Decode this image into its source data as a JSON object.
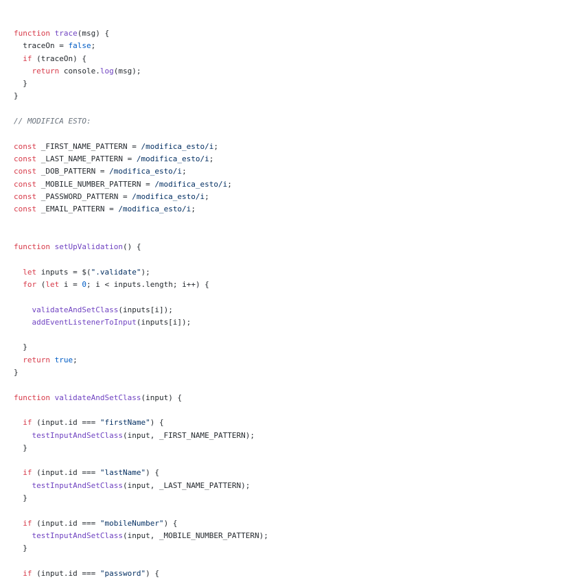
{
  "lines": [
    [
      {
        "t": "kw",
        "v": "function"
      },
      {
        "t": "p",
        "v": " "
      },
      {
        "t": "fn",
        "v": "trace"
      },
      {
        "t": "p",
        "v": "(msg) {"
      }
    ],
    [
      {
        "t": "p",
        "v": "  traceOn = "
      },
      {
        "t": "lit",
        "v": "false"
      },
      {
        "t": "p",
        "v": ";"
      }
    ],
    [
      {
        "t": "p",
        "v": "  "
      },
      {
        "t": "kw",
        "v": "if"
      },
      {
        "t": "p",
        "v": " (traceOn) {"
      }
    ],
    [
      {
        "t": "p",
        "v": "    "
      },
      {
        "t": "kw",
        "v": "return"
      },
      {
        "t": "p",
        "v": " console."
      },
      {
        "t": "fn",
        "v": "log"
      },
      {
        "t": "p",
        "v": "(msg);"
      }
    ],
    [
      {
        "t": "p",
        "v": "  }"
      }
    ],
    [
      {
        "t": "p",
        "v": "}"
      }
    ],
    [],
    [
      {
        "t": "cm",
        "v": "// MODIFICA ESTO:"
      }
    ],
    [],
    [
      {
        "t": "kw",
        "v": "const"
      },
      {
        "t": "p",
        "v": " _FIRST_NAME_PATTERN = "
      },
      {
        "t": "str",
        "v": "/modifica_esto/i"
      },
      {
        "t": "p",
        "v": ";"
      }
    ],
    [
      {
        "t": "kw",
        "v": "const"
      },
      {
        "t": "p",
        "v": " _LAST_NAME_PATTERN = "
      },
      {
        "t": "str",
        "v": "/modifica_esto/i"
      },
      {
        "t": "p",
        "v": ";"
      }
    ],
    [
      {
        "t": "kw",
        "v": "const"
      },
      {
        "t": "p",
        "v": " _DOB_PATTERN = "
      },
      {
        "t": "str",
        "v": "/modifica_esto/i"
      },
      {
        "t": "p",
        "v": ";"
      }
    ],
    [
      {
        "t": "kw",
        "v": "const"
      },
      {
        "t": "p",
        "v": " _MOBILE_NUMBER_PATTERN = "
      },
      {
        "t": "str",
        "v": "/modifica_esto/i"
      },
      {
        "t": "p",
        "v": ";"
      }
    ],
    [
      {
        "t": "kw",
        "v": "const"
      },
      {
        "t": "p",
        "v": " _PASSWORD_PATTERN = "
      },
      {
        "t": "str",
        "v": "/modifica_esto/i"
      },
      {
        "t": "p",
        "v": ";"
      }
    ],
    [
      {
        "t": "kw",
        "v": "const"
      },
      {
        "t": "p",
        "v": " _EMAIL_PATTERN = "
      },
      {
        "t": "str",
        "v": "/modifica_esto/i"
      },
      {
        "t": "p",
        "v": ";"
      }
    ],
    [],
    [],
    [
      {
        "t": "kw",
        "v": "function"
      },
      {
        "t": "p",
        "v": " "
      },
      {
        "t": "fn",
        "v": "setUpValidation"
      },
      {
        "t": "p",
        "v": "() {"
      }
    ],
    [],
    [
      {
        "t": "p",
        "v": "  "
      },
      {
        "t": "kw",
        "v": "let"
      },
      {
        "t": "p",
        "v": " inputs = $("
      },
      {
        "t": "str",
        "v": "\".validate\""
      },
      {
        "t": "p",
        "v": ");"
      }
    ],
    [
      {
        "t": "p",
        "v": "  "
      },
      {
        "t": "kw",
        "v": "for"
      },
      {
        "t": "p",
        "v": " ("
      },
      {
        "t": "kw",
        "v": "let"
      },
      {
        "t": "p",
        "v": " i = "
      },
      {
        "t": "lit",
        "v": "0"
      },
      {
        "t": "p",
        "v": "; i < inputs.length; i++) {"
      }
    ],
    [],
    [
      {
        "t": "p",
        "v": "    "
      },
      {
        "t": "fn",
        "v": "validateAndSetClass"
      },
      {
        "t": "p",
        "v": "(inputs[i]);"
      }
    ],
    [
      {
        "t": "p",
        "v": "    "
      },
      {
        "t": "fn",
        "v": "addEventListenerToInput"
      },
      {
        "t": "p",
        "v": "(inputs[i]);"
      }
    ],
    [],
    [
      {
        "t": "p",
        "v": "  }"
      }
    ],
    [
      {
        "t": "p",
        "v": "  "
      },
      {
        "t": "kw",
        "v": "return"
      },
      {
        "t": "p",
        "v": " "
      },
      {
        "t": "lit",
        "v": "true"
      },
      {
        "t": "p",
        "v": ";"
      }
    ],
    [
      {
        "t": "p",
        "v": "}"
      }
    ],
    [],
    [
      {
        "t": "kw",
        "v": "function"
      },
      {
        "t": "p",
        "v": " "
      },
      {
        "t": "fn",
        "v": "validateAndSetClass"
      },
      {
        "t": "p",
        "v": "(input) {"
      }
    ],
    [],
    [
      {
        "t": "p",
        "v": "  "
      },
      {
        "t": "kw",
        "v": "if"
      },
      {
        "t": "p",
        "v": " (input.id === "
      },
      {
        "t": "str",
        "v": "\"firstName\""
      },
      {
        "t": "p",
        "v": ") {"
      }
    ],
    [
      {
        "t": "p",
        "v": "    "
      },
      {
        "t": "fn",
        "v": "testInputAndSetClass"
      },
      {
        "t": "p",
        "v": "(input, _FIRST_NAME_PATTERN);"
      }
    ],
    [
      {
        "t": "p",
        "v": "  }"
      }
    ],
    [],
    [
      {
        "t": "p",
        "v": "  "
      },
      {
        "t": "kw",
        "v": "if"
      },
      {
        "t": "p",
        "v": " (input.id === "
      },
      {
        "t": "str",
        "v": "\"lastName\""
      },
      {
        "t": "p",
        "v": ") {"
      }
    ],
    [
      {
        "t": "p",
        "v": "    "
      },
      {
        "t": "fn",
        "v": "testInputAndSetClass"
      },
      {
        "t": "p",
        "v": "(input, _LAST_NAME_PATTERN);"
      }
    ],
    [
      {
        "t": "p",
        "v": "  }"
      }
    ],
    [],
    [
      {
        "t": "p",
        "v": "  "
      },
      {
        "t": "kw",
        "v": "if"
      },
      {
        "t": "p",
        "v": " (input.id === "
      },
      {
        "t": "str",
        "v": "\"mobileNumber\""
      },
      {
        "t": "p",
        "v": ") {"
      }
    ],
    [
      {
        "t": "p",
        "v": "    "
      },
      {
        "t": "fn",
        "v": "testInputAndSetClass"
      },
      {
        "t": "p",
        "v": "(input, _MOBILE_NUMBER_PATTERN);"
      }
    ],
    [
      {
        "t": "p",
        "v": "  }"
      }
    ],
    [],
    [
      {
        "t": "p",
        "v": "  "
      },
      {
        "t": "kw",
        "v": "if"
      },
      {
        "t": "p",
        "v": " (input.id === "
      },
      {
        "t": "str",
        "v": "\"password\""
      },
      {
        "t": "p",
        "v": ") {"
      }
    ]
  ]
}
